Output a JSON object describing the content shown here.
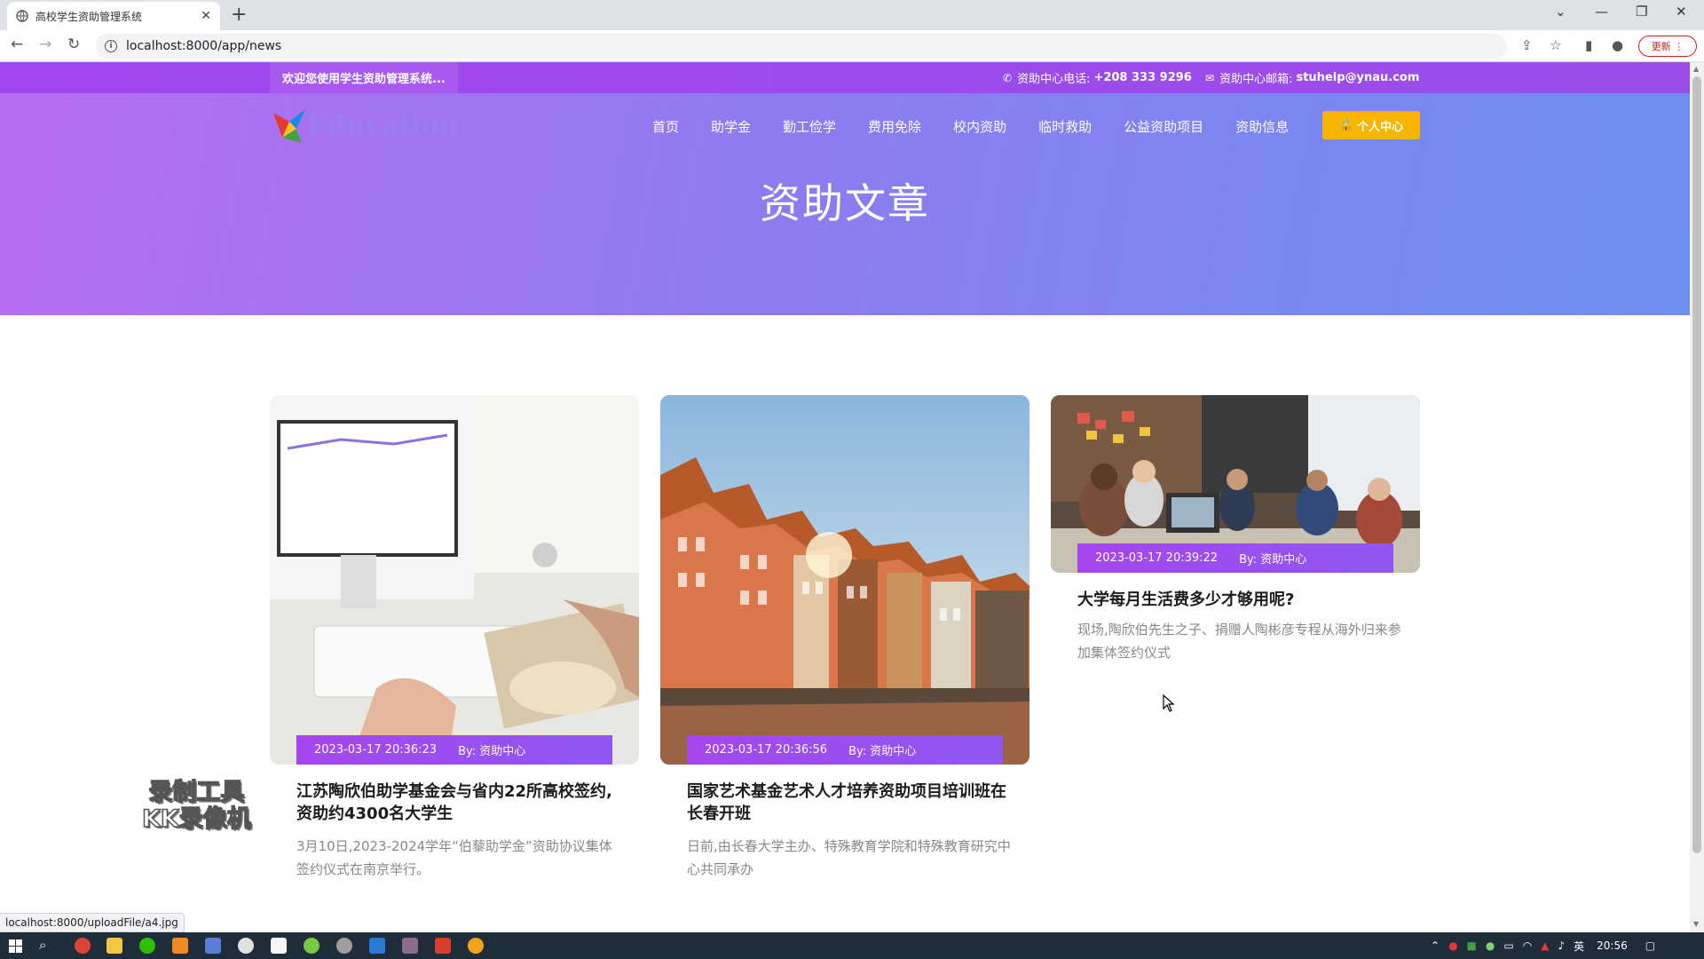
{
  "browser": {
    "tab_title": "高校学生资助管理系统",
    "url": "localhost:8000/app/news",
    "update_label": "更新"
  },
  "topbar": {
    "welcome": "欢迎您使用学生资助管理系统...",
    "phone_label": "资助中心电话:",
    "phone": "+208 333 9296",
    "email_label": "资助中心邮箱:",
    "email": "stuhelp@ynau.com"
  },
  "header": {
    "logo_text": "Education",
    "menu": [
      "首页",
      "助学金",
      "勤工俭学",
      "费用免除",
      "校内资助",
      "临时救助",
      "公益资助项目",
      "资助信息"
    ],
    "user_center": "个人中心",
    "page_title": "资助文章"
  },
  "articles": [
    {
      "date": "2023-03-17 20:36:23",
      "author": "By: 资助中心",
      "title": "江苏陶欣伯助学基金会与省内22所高校签约,资助约4300名大学生",
      "desc": "3月10日,2023-2024学年“伯藜助学金”资助协议集体签约仪式在南京举行。"
    },
    {
      "date": "2023-03-17 20:36:56",
      "author": "By: 资助中心",
      "title": "国家艺术基金艺术人才培养资助项目培训班在长春开班",
      "desc": "日前,由长春大学主办、特殊教育学院和特殊教育研究中心共同承办"
    },
    {
      "date": "2023-03-17 20:39:22",
      "author": "By: 资助中心",
      "title": "大学每月生活费多少才够用呢?",
      "desc": "现场,陶欣伯先生之子、捐赠人陶彬彦专程从海外归来参加集体签约仪式"
    }
  ],
  "watermark": {
    "line1": "录制工具",
    "line2": "KK录像机"
  },
  "status_url": "localhost:8000/uploadFile/a4.jpg",
  "taskbar": {
    "ime": "英",
    "time": "20:56"
  },
  "colors": {
    "topbar": "#9a4ee8",
    "hero_start": "#b76cf3",
    "hero_end": "#6c8ff0",
    "accent_button": "#f7b500",
    "meta_bar": "#9a4dee"
  }
}
